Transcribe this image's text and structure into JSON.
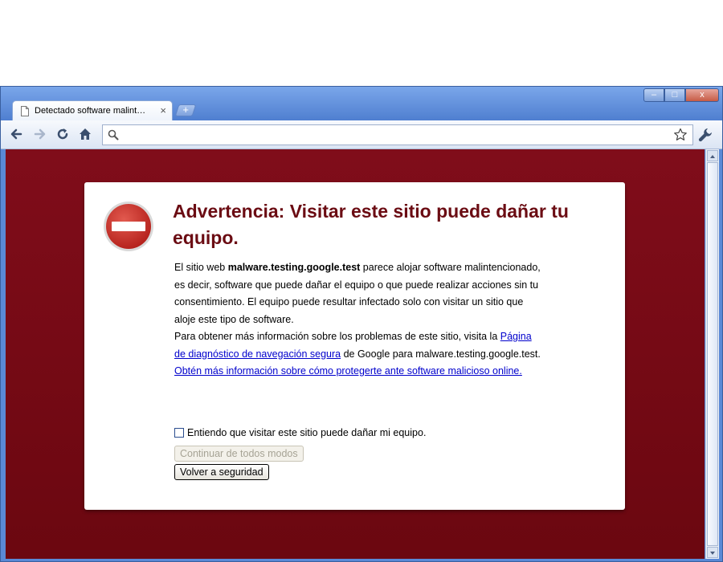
{
  "browser": {
    "tab_title": "Detectado software malint…",
    "tab_close": "×",
    "new_tab": "+",
    "icons": {
      "back": "back-arrow-icon",
      "forward": "forward-arrow-icon",
      "reload": "reload-icon",
      "home": "home-icon",
      "search": "search-icon",
      "star": "star-icon",
      "wrench": "wrench-icon"
    },
    "address_value": "",
    "window_controls": {
      "minimize": "–",
      "maximize": "□",
      "close": "x"
    }
  },
  "warning": {
    "title": "Advertencia: Visitar este sitio puede dañar tu equipo.",
    "p1_pre": "El sitio web ",
    "p1_site": "malware.testing.google.test",
    "p1_post": " parece alojar software malintencionado, es decir, software que puede dañar el equipo o que puede realizar acciones sin tu consentimiento. El equipo puede resultar infectado solo con visitar un sitio que aloje este tipo de software.",
    "p2_pre": "Para obtener más información sobre los problemas de este sitio, visita la ",
    "p2_link": "Página de diagnóstico de navegación segura",
    "p2_post": " de Google para malware.testing.google.test.",
    "p3_link": "Obtén más información sobre cómo protegerte ante software malicioso online.",
    "checkbox_label": "Entiendo que visitar este sitio puede dañar mi equipo.",
    "checkbox_checked": false,
    "continue_button": "Continuar de todos modos",
    "back_button": "Volver a seguridad",
    "colors": {
      "background": "#800d1a",
      "title": "#6b0c13",
      "stop_icon": "#c9322c",
      "link": "#0000cc"
    }
  }
}
